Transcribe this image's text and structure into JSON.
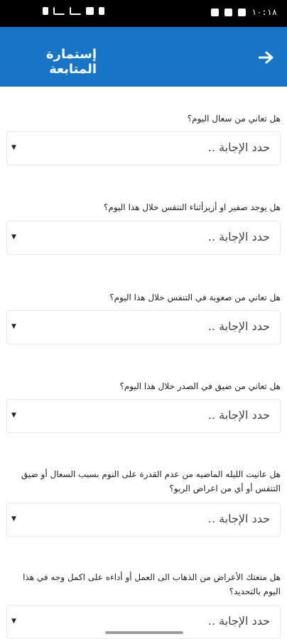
{
  "status_bar": {
    "time": "١٠:١٨"
  },
  "app_bar": {
    "title": "إستمارة المتابعة",
    "back_icon": "arrow-right-icon"
  },
  "questions": [
    {
      "text": "هل تعاني من سعال اليوم؟",
      "placeholder": "حدد الإجابة .."
    },
    {
      "text": "هل يوجد صفير او أزيزأثناء التنفس خلال هذا اليوم؟",
      "placeholder": "حدد الإجابة .."
    },
    {
      "text": "هل تعاني من صعوبة في التنفس خلال هذا اليوم؟",
      "placeholder": "حدد الإجابة .."
    },
    {
      "text": "هل تعاني من ضيق في الصدر خلال هذا اليوم؟",
      "placeholder": "حدد الإجابة .."
    },
    {
      "text": "هل عانيت الليله الماضيه من عدم القدرة على النوم بسبب السعال أو ضيق التنفس أو أي من اعراض الربو؟",
      "placeholder": "حدد الإجابة .."
    },
    {
      "text": "هل منعتك الأعراض من الذهاب الى العمل أو أداءه على اكمل وجه في هذا اليوم بالتحديد؟",
      "placeholder": "حدد الإجابة .."
    }
  ],
  "colors": {
    "app_bar": "#1675c7",
    "status_bar": "#000000"
  }
}
